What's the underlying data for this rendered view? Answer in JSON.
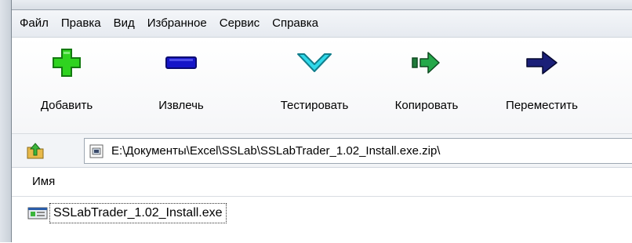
{
  "menu": [
    {
      "label": "Файл"
    },
    {
      "label": "Правка"
    },
    {
      "label": "Вид"
    },
    {
      "label": "Избранное"
    },
    {
      "label": "Сервис"
    },
    {
      "label": "Справка"
    }
  ],
  "toolbar": {
    "add_label": "Добавить",
    "extract_label": "Извлечь",
    "test_label": "Тестировать",
    "copy_label": "Копировать",
    "move_label": "Переместить",
    "colors": {
      "add": "#2fd31f",
      "extract": "#1515c8",
      "test": "#2fd9ea",
      "copy": "#25a84a",
      "move": "#1a1f78"
    }
  },
  "address": {
    "path": "E:\\Документы\\Excel\\SSLab\\SSLabTrader_1.02_Install.exe.zip\\"
  },
  "list": {
    "column_name": "Имя",
    "items": [
      {
        "name": "SSLabTrader_1.02_Install.exe"
      }
    ]
  }
}
